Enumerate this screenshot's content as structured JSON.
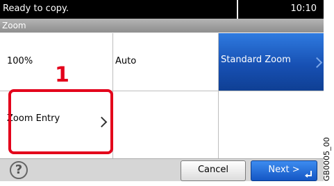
{
  "status": {
    "message": "Ready to copy.",
    "time": "10:10"
  },
  "title": "Zoom",
  "options": {
    "p100": "100%",
    "auto": "Auto",
    "standard_zoom": "Standard Zoom",
    "zoom_entry": "Zoom Entry"
  },
  "buttons": {
    "cancel": "Cancel",
    "next": "Next >",
    "help": "?"
  },
  "callout": {
    "number": "1"
  },
  "figure_code": "GB0005_00",
  "colors": {
    "selected": "#1750b3",
    "callout": "#e3001b"
  }
}
